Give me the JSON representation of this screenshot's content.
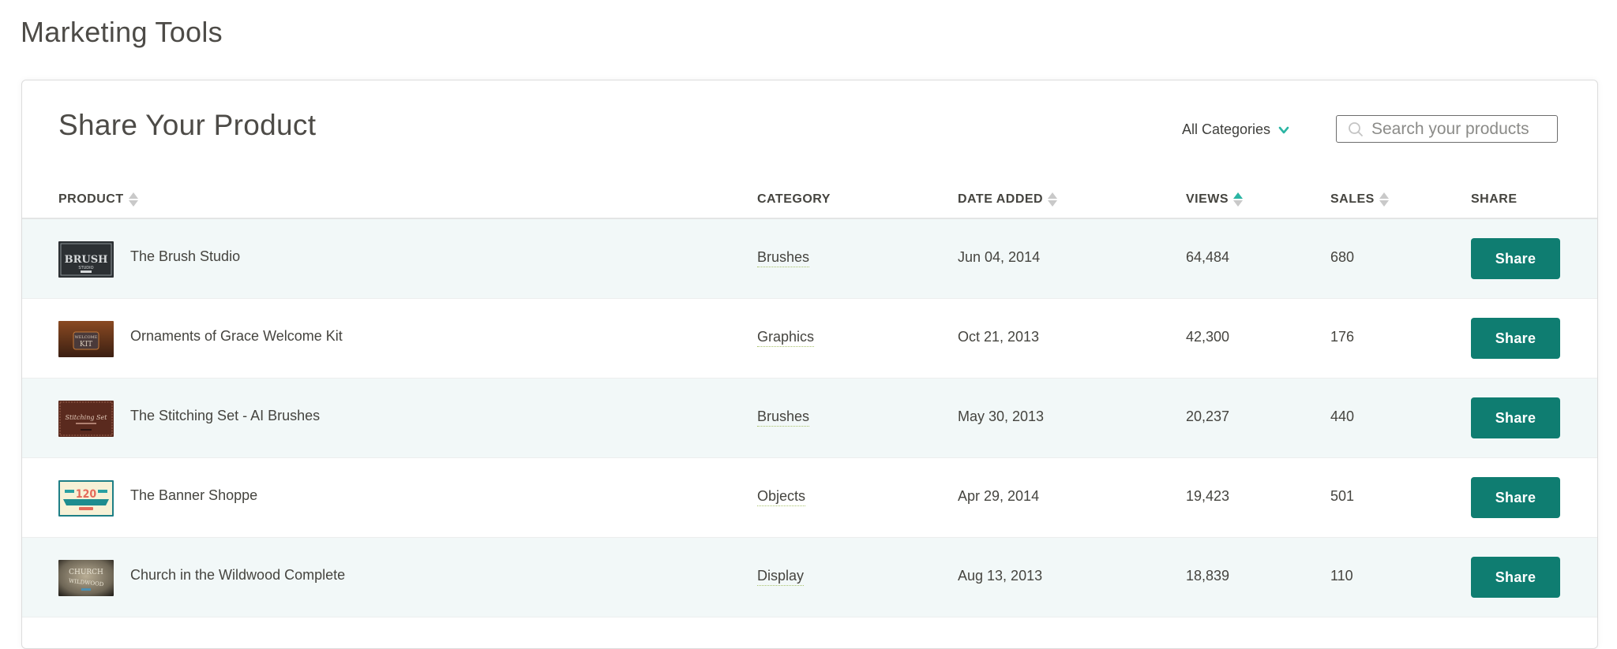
{
  "page": {
    "title": "Marketing Tools"
  },
  "card": {
    "title": "Share Your Product",
    "category_filter": {
      "selected": "All Categories",
      "icon": "chevron-down-icon"
    },
    "search": {
      "placeholder": "Search your products",
      "value": "",
      "icon": "search-icon"
    }
  },
  "table": {
    "columns": [
      {
        "key": "product",
        "label": "PRODUCT",
        "sortable": true,
        "sort": "none"
      },
      {
        "key": "category",
        "label": "CATEGORY",
        "sortable": false
      },
      {
        "key": "date_added",
        "label": "DATE ADDED",
        "sortable": true,
        "sort": "none"
      },
      {
        "key": "views",
        "label": "VIEWS",
        "sortable": true,
        "sort": "ascending-active"
      },
      {
        "key": "sales",
        "label": "SALES",
        "sortable": true,
        "sort": "none"
      },
      {
        "key": "share",
        "label": "SHARE",
        "sortable": false
      }
    ],
    "rows": [
      {
        "product": "The Brush Studio",
        "category": "Brushes",
        "date_added": "Jun 04, 2014",
        "views": "64,484",
        "sales": "680",
        "share_label": "Share",
        "thumb": "brush-studio-thumbnail"
      },
      {
        "product": "Ornaments of Grace Welcome Kit",
        "category": "Graphics",
        "date_added": "Oct 21, 2013",
        "views": "42,300",
        "sales": "176",
        "share_label": "Share",
        "thumb": "welcome-kit-thumbnail"
      },
      {
        "product": "The Stitching Set - AI Brushes",
        "category": "Brushes",
        "date_added": "May 30, 2013",
        "views": "20,237",
        "sales": "440",
        "share_label": "Share",
        "thumb": "stitching-set-thumbnail"
      },
      {
        "product": "The Banner Shoppe",
        "category": "Objects",
        "date_added": "Apr 29, 2014",
        "views": "19,423",
        "sales": "501",
        "share_label": "Share",
        "thumb": "banner-shoppe-thumbnail"
      },
      {
        "product": "Church in the Wildwood Complete",
        "category": "Display",
        "date_added": "Aug 13, 2013",
        "views": "18,839",
        "sales": "110",
        "share_label": "Share",
        "thumb": "church-wildwood-thumbnail"
      }
    ]
  },
  "colors": {
    "accent": "#2bb5a3",
    "share_button": "#0f7d71",
    "row_alt_bg": "#f2f8f8",
    "category_underline": "#a9c36c",
    "text": "#45443f"
  }
}
